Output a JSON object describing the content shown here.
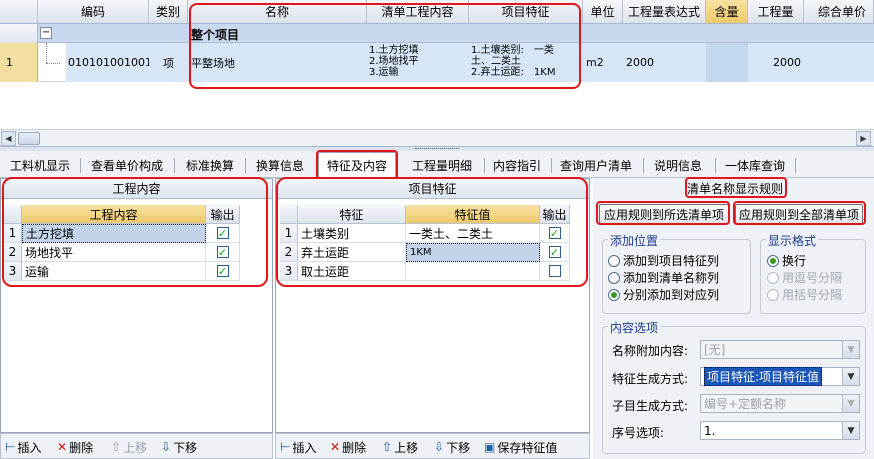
{
  "top_grid": {
    "columns": [
      "编码",
      "类别",
      "名称",
      "清单工程内容",
      "项目特征",
      "单位",
      "工程量表达式",
      "含量",
      "工程量",
      "综合单价"
    ],
    "group_toggle": "−",
    "group_title": "整个项目",
    "row": {
      "num": "1",
      "code": "010101001001",
      "type": "项",
      "name": "平整场地",
      "content_lines": [
        "1.土方挖填",
        "2.场地找平",
        "3.运输"
      ],
      "feature_lines": [
        "1.土壤类别:　一类",
        "土、二类土",
        "2.弃土运距:　1KM"
      ],
      "unit": "m2",
      "expr": "2000",
      "qty": "2000"
    }
  },
  "tabs": [
    "工料机显示",
    "查看单价构成",
    "标准换算",
    "换算信息",
    "特征及内容",
    "工程量明细",
    "内容指引",
    "查询用户清单",
    "说明信息",
    "一体库查询"
  ],
  "active_tab": "特征及内容",
  "work_content": {
    "title": "工程内容",
    "col_content": "工程内容",
    "col_output": "输出",
    "rows": [
      {
        "num": "1",
        "text": "土方挖填",
        "checked": true
      },
      {
        "num": "2",
        "text": "场地找平",
        "checked": true
      },
      {
        "num": "3",
        "text": "运输",
        "checked": true
      }
    ]
  },
  "features": {
    "title": "项目特征",
    "col_feature": "特征",
    "col_value": "特征值",
    "col_output": "输出",
    "rows": [
      {
        "num": "1",
        "feature": "土壤类别",
        "value": "一类土、二类土",
        "checked": true
      },
      {
        "num": "2",
        "feature": "弃土运距",
        "value": "1KM",
        "checked": true
      },
      {
        "num": "3",
        "feature": "取土运距",
        "value": "",
        "checked": false
      }
    ]
  },
  "left_toolbar": {
    "insert": "插入",
    "delete": "删除",
    "up": "上移",
    "down": "下移"
  },
  "mid_toolbar": {
    "insert": "插入",
    "delete": "删除",
    "up": "上移",
    "down": "下移",
    "save": "保存特征值"
  },
  "rules": {
    "title": "清单名称显示规则",
    "apply_selected": "应用规则到所选清单项",
    "apply_all": "应用规则到全部清单项",
    "add_position": {
      "label": "添加位置",
      "options": [
        "添加到项目特征列",
        "添加到清单名称列",
        "分别添加到对应列"
      ],
      "selected": 2
    },
    "display_format": {
      "label": "显示格式",
      "options": [
        "换行",
        "用逗号分隔",
        "用括号分隔"
      ],
      "selected": 0
    },
    "content_options": {
      "label": "内容选项",
      "name_suffix_label": "名称附加内容:",
      "name_suffix_value": "[无]",
      "feature_mode_label": "特征生成方式:",
      "feature_mode_value": "项目特征:项目特征值",
      "sub_mode_label": "子目生成方式:",
      "sub_mode_value": "编号+定额名称",
      "seq_label": "序号选项:",
      "seq_value": "1."
    }
  }
}
